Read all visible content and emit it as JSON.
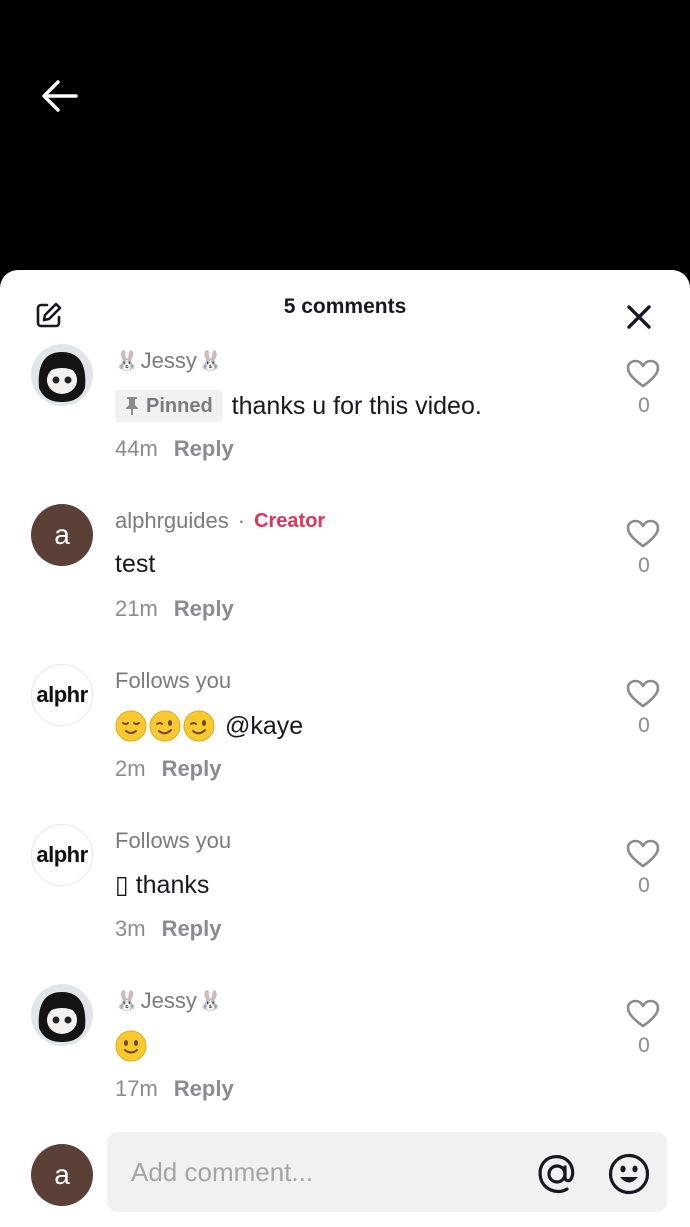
{
  "header": {
    "back_icon": "arrow-left-icon",
    "title": "5 comments",
    "edit_icon": "edit-icon",
    "close_icon": "close-icon"
  },
  "comments": [
    {
      "username": "Jessy",
      "avatar": "photo",
      "pinned_label": "Pinned",
      "text": "thanks u for this video.",
      "time": "44m",
      "reply_label": "Reply",
      "likes": "0"
    },
    {
      "username": "alphrguides",
      "avatar_letter": "a",
      "creator_label": "Creator",
      "text": "test",
      "time": "21m",
      "reply_label": "Reply",
      "likes": "0"
    },
    {
      "username": "Follows you",
      "avatar_text": "alphr",
      "text": "@kaye",
      "emojis": [
        "relieved-face",
        "winking-face",
        "winking-face"
      ],
      "time": "2m",
      "reply_label": "Reply",
      "likes": "0"
    },
    {
      "username": "Follows you",
      "avatar_text": "alphr",
      "text": "▯ thanks",
      "time": "3m",
      "reply_label": "Reply",
      "likes": "0"
    },
    {
      "username": "Jessy",
      "avatar": "photo",
      "emojis": [
        "slightly-smiling-face"
      ],
      "time": "17m",
      "reply_label": "Reply",
      "likes": "0"
    }
  ],
  "composer": {
    "avatar_letter": "a",
    "placeholder": "Add comment...",
    "mention_icon": "at-sign-icon",
    "emoji_icon": "emoji-icon"
  },
  "colors": {
    "creator": "#e0335a",
    "muted": "#8a8b91",
    "avatar_bg": "#5b4037"
  }
}
